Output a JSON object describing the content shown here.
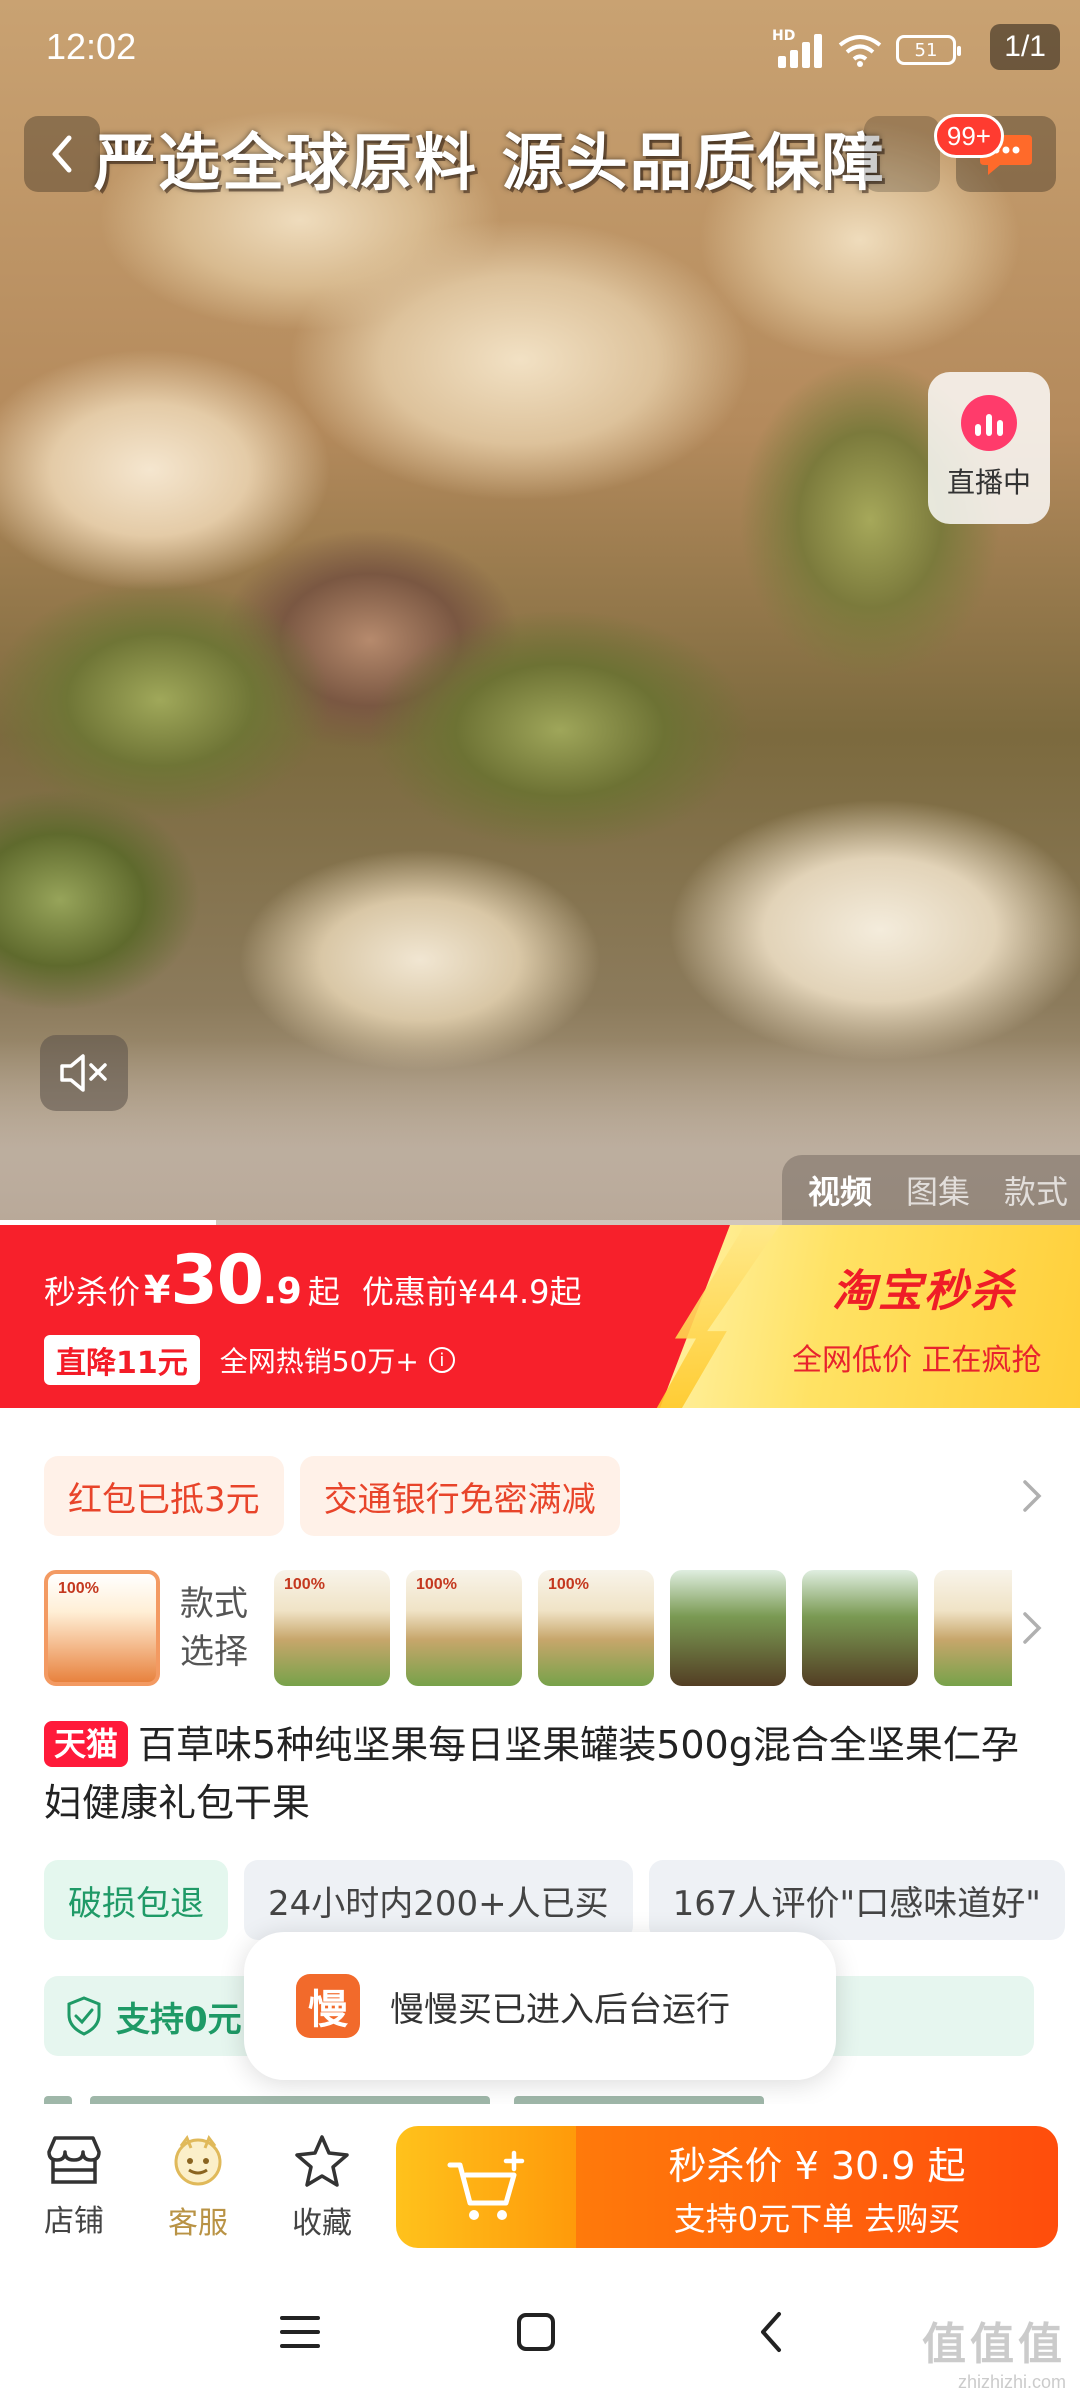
{
  "status_bar": {
    "time": "12:02",
    "network_label": "HD",
    "battery": "51",
    "icons": [
      "signal-icon",
      "wifi-icon",
      "battery-icon"
    ]
  },
  "media": {
    "page_indicator": "1/1",
    "headline": "严选全球原料 源头品质保障",
    "message_badge": "99+",
    "live_label": "直播中",
    "tabs": [
      {
        "label": "视频",
        "active": true
      },
      {
        "label": "图集",
        "active": false
      },
      {
        "label": "款式",
        "active": false
      }
    ],
    "video_progress": 0.2
  },
  "flash_sale": {
    "price_label": "秒杀价",
    "currency": "¥",
    "price_int": "30",
    "price_dec": ".9",
    "price_suffix": "起",
    "price_before": "优惠前¥44.9起",
    "drop_badge": "直降11元",
    "hot_sales": "全网热销50万+",
    "brand_logo": "淘宝秒杀",
    "slogan": "全网低价 正在疯抢",
    "colors": {
      "banner": "#f7202b",
      "accent_yellow": "#ffd94a"
    }
  },
  "coupons": [
    "红包已抵3元",
    "交通银行免密满减"
  ],
  "variants": {
    "label": "款式选择",
    "thumb_captions": [
      "100%",
      "100%",
      "100%"
    ]
  },
  "product": {
    "badge": "天猫",
    "title": "百草味5种纯坚果每日坚果罐装500g混合全坚果仁孕妇健康礼包干果"
  },
  "highlights": [
    {
      "label": "破损包退",
      "style": "green"
    },
    {
      "label": "24小时内200+人已买",
      "style": "gray"
    },
    {
      "label": "167人评价\"口感味道好\"",
      "style": "gray"
    }
  ],
  "support": {
    "label": "支持0元"
  },
  "toast": {
    "icon_char": "慢",
    "text": "慢慢买已进入后台运行"
  },
  "action_bar": {
    "shop": "店铺",
    "service": "客服",
    "favorite": "收藏",
    "buy_line1": "秒杀价 ¥ 30.9 起",
    "buy_line2": "支持0元下单  去购买"
  },
  "watermark": {
    "mark": "值值值",
    "site": "zhizhizhi.com"
  }
}
